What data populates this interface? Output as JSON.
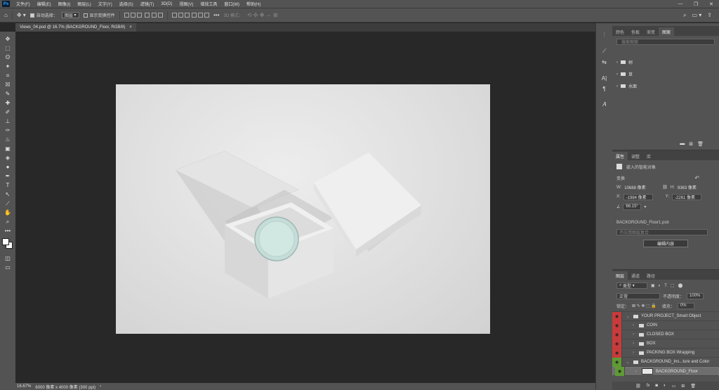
{
  "app": {
    "logo": "Ps"
  },
  "menu": [
    "文件(F)",
    "编辑(E)",
    "图像(I)",
    "图层(L)",
    "文字(Y)",
    "选择(S)",
    "滤镜(T)",
    "3D(D)",
    "视图(V)",
    "增效工具",
    "窗口(W)",
    "帮助(H)"
  ],
  "window_controls": {
    "minimize": "—",
    "restore": "❐",
    "close": "✕"
  },
  "options_bar": {
    "auto_select_label": "自动选择：",
    "auto_select_value": "图层",
    "show_transform_label": "显示变换控件",
    "mode_3d_label": "3D 模式：",
    "more": "•••"
  },
  "doc_tab": {
    "title": "Views_04.psd @ 16.7% (BACKGROUND_Floor, RGB/8)",
    "close": "×"
  },
  "status": {
    "zoom": "16.67%",
    "doc_info": "6000 像素 x 4000 像素 (300 ppi)",
    "arrow": "›"
  },
  "toolbar_glyphs": [
    "✥",
    "⬚",
    "ʘ",
    "✦",
    "⌗",
    "☒",
    "✎",
    "✚",
    "✐",
    "⊥",
    "✑",
    "♨",
    "▣",
    "◈",
    "●",
    "✒",
    "T",
    "↖",
    "⟋",
    "✋",
    "⌕",
    "•••"
  ],
  "right_icon_glyphs": [
    "⫶",
    "⟋",
    "⇆",
    "A|",
    "¶",
    "𝐴"
  ],
  "color_panel": {
    "tabs": [
      "颜色",
      "色板",
      "渐变",
      "图案"
    ],
    "active_tab": 3,
    "search_placeholder": "搜索图案",
    "folders": [
      "树",
      "草",
      "水面"
    ]
  },
  "properties_panel": {
    "tabs": [
      "属性",
      "调整",
      "库"
    ],
    "active_tab": 0,
    "header": "嵌入的智能对象",
    "transform_label": "变换",
    "w_label": "W:",
    "w_value": "10688 像素",
    "h_label": "H:",
    "h_value": "9363 像素",
    "x_label": "X:",
    "x_value": "-1984 像素",
    "y_label": "Y:",
    "y_value": "-2261 像素",
    "angle_value": "66.15°",
    "file_name": "BACKGROUND_Floor1.psb",
    "comp_placeholder": "不应用图层复合",
    "edit_button": "编辑内容"
  },
  "layers_panel": {
    "tabs": [
      "图层",
      "通道",
      "路径"
    ],
    "active_tab": 0,
    "filter_label": "类型",
    "filter_icons": [
      "▣",
      "◐",
      "T",
      "⬚",
      "⬤"
    ],
    "blend_mode": "正常",
    "opacity_label": "不透明度：",
    "opacity_value": "100%",
    "lock_label": "锁定：",
    "lock_icons": "⊠ ✎ ✥ ⬚ 🔒",
    "fill_label": "填充：",
    "fill_value": "0%",
    "layers": [
      {
        "name": "YOUR PROJECT_Smart Object",
        "eye": "red",
        "indent": 0
      },
      {
        "name": "COIN",
        "eye": "red",
        "indent": 1
      },
      {
        "name": "CLOSED BOX",
        "eye": "red",
        "indent": 1
      },
      {
        "name": "BOX",
        "eye": "red",
        "indent": 1
      },
      {
        "name": "PACKING BOX Wrapping",
        "eye": "red",
        "indent": 1
      },
      {
        "name": "BACKGROUND_Ins...ture and Color",
        "eye": "green",
        "indent": 0
      },
      {
        "name": "BACKGROUND_Floor",
        "eye": "green",
        "indent": 1
      }
    ],
    "footer_icons": [
      "⛓",
      "fx",
      "◙",
      "◐",
      "▭",
      "⊞",
      "🗑"
    ]
  }
}
